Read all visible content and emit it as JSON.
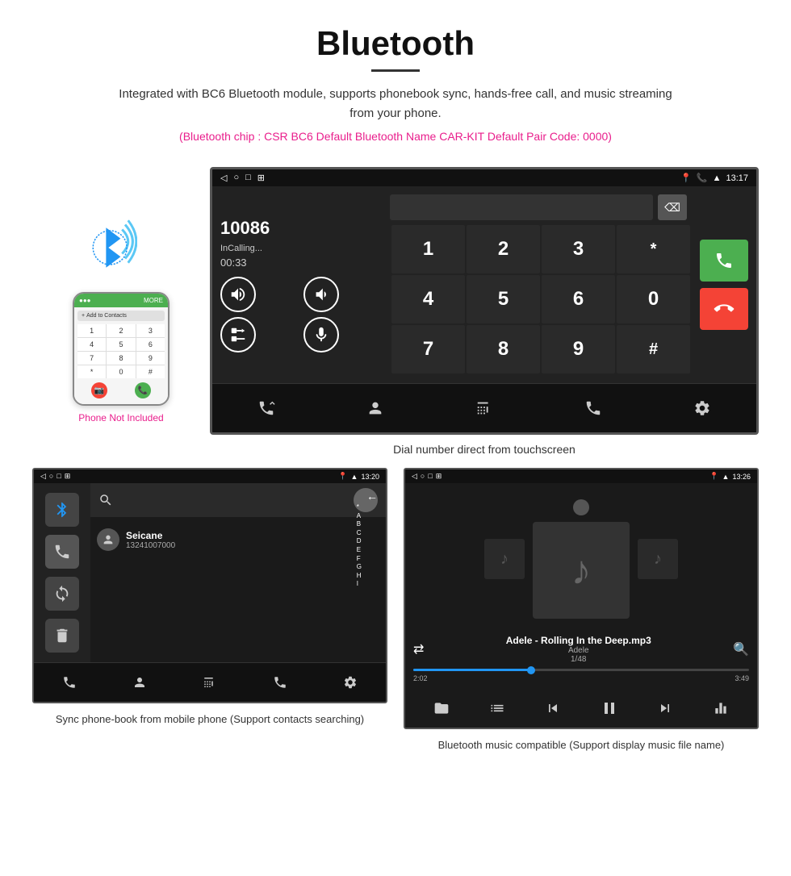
{
  "header": {
    "title": "Bluetooth",
    "description": "Integrated with BC6 Bluetooth module, supports phonebook sync, hands-free call, and music streaming from your phone.",
    "specs": "(Bluetooth chip : CSR BC6    Default Bluetooth Name CAR-KIT    Default Pair Code: 0000)"
  },
  "phone_label": "Phone Not Included",
  "car_screen": {
    "statusbar": {
      "left": [
        "◁",
        "○",
        "□",
        "⊞"
      ],
      "right_icons": [
        "📍",
        "📞",
        "📶"
      ],
      "time": "13:17"
    },
    "dial": {
      "number": "10086",
      "status": "InCalling...",
      "timer": "00:33"
    },
    "keypad_keys": [
      "1",
      "2",
      "3",
      "*",
      "4",
      "5",
      "6",
      "0",
      "7",
      "8",
      "9",
      "#"
    ]
  },
  "screen_caption": "Dial number direct from touchscreen",
  "phonebook_screen": {
    "statusbar_time": "13:20",
    "contact_name": "Seicane",
    "contact_number": "13241007000",
    "alphabet": [
      "*",
      "A",
      "B",
      "C",
      "D",
      "E",
      "F",
      "G",
      "H",
      "I"
    ]
  },
  "music_screen": {
    "statusbar_time": "13:26",
    "song_title": "Adele - Rolling In the Deep.mp3",
    "artist": "Adele",
    "track_count": "1/48",
    "time_current": "2:02",
    "time_total": "3:49",
    "progress_percent": 35
  },
  "captions": {
    "phonebook": "Sync phone-book from mobile phone\n(Support contacts searching)",
    "music": "Bluetooth music compatible\n(Support display music file name)"
  },
  "phone_keys": [
    [
      "1",
      "2",
      "3"
    ],
    [
      "4",
      "5",
      "6"
    ],
    [
      "7",
      "8",
      "9"
    ],
    [
      "*",
      "0",
      "#"
    ]
  ]
}
